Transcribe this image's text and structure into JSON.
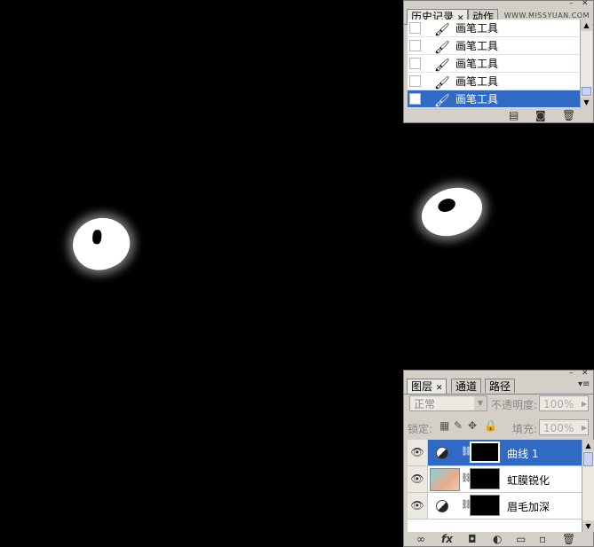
{
  "history_panel": {
    "tabs": [
      "历史记录",
      "动作"
    ],
    "watermark": "WWW.MISSYUAN.COM",
    "items": [
      {
        "label": "画笔工具",
        "selected": false
      },
      {
        "label": "画笔工具",
        "selected": false
      },
      {
        "label": "画笔工具",
        "selected": false
      },
      {
        "label": "画笔工具",
        "selected": false
      },
      {
        "label": "画笔工具",
        "selected": true
      }
    ],
    "footer_icons": [
      "new-document-icon",
      "camera-icon",
      "trash-icon"
    ]
  },
  "layers_panel": {
    "tabs": [
      "图层",
      "通道",
      "路径"
    ],
    "blend_mode": "正常",
    "opacity_label": "不透明度:",
    "opacity_value": "100%",
    "lock_label": "锁定:",
    "fill_label": "填充:",
    "fill_value": "100%",
    "layers": [
      {
        "name": "曲线 1",
        "type": "adjustment",
        "selected": true
      },
      {
        "name": "虹膜锐化",
        "type": "image",
        "selected": false
      },
      {
        "name": "眉毛加深",
        "type": "adjustment",
        "selected": false
      }
    ],
    "footer_icons": [
      "link-icon",
      "fx-icon",
      "mask-icon",
      "adjustment-icon",
      "folder-icon",
      "new-layer-icon",
      "trash-icon"
    ]
  },
  "colors": {
    "selection": "#316ac5",
    "panel": "#d4d0c8",
    "canvas": "#000000"
  }
}
